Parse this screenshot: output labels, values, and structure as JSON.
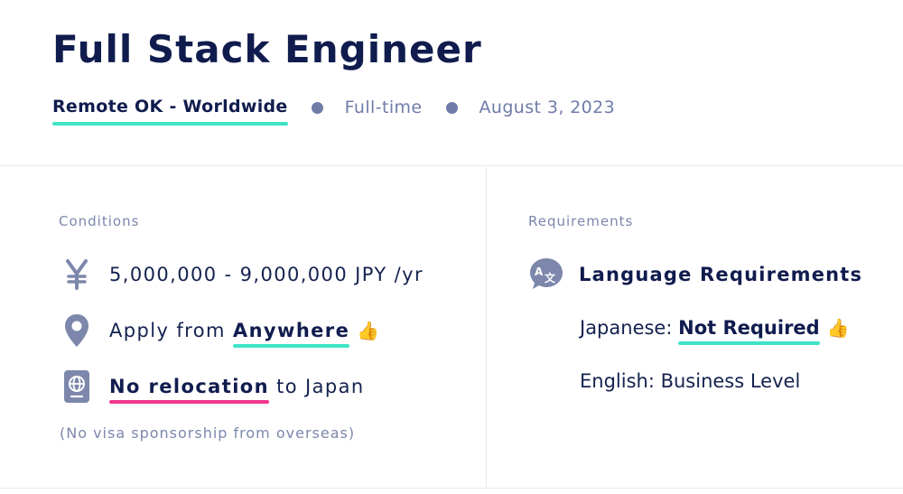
{
  "job": {
    "title": "Full Stack Engineer",
    "location": "Remote OK - Worldwide",
    "type": "Full-time",
    "date": "August 3, 2023"
  },
  "conditions": {
    "label": "Conditions",
    "salary": "5,000,000 - 9,000,000 JPY /yr",
    "apply_prefix": "Apply from",
    "apply_highlight": "Anywhere",
    "relocation_highlight": "No relocation",
    "relocation_suffix": "to Japan",
    "note": "(No visa sponsorship from overseas)",
    "thumbs_emoji": "👍"
  },
  "requirements": {
    "label": "Requirements",
    "heading": "Language Requirements",
    "japanese_prefix": "Japanese:",
    "japanese_value": "Not Required",
    "english": "English: Business Level",
    "thumbs_emoji": "👍"
  },
  "icons": {
    "salary": "yen-icon",
    "location": "map-pin-icon",
    "relocation": "passport-icon",
    "language": "translate-icon"
  },
  "colors": {
    "title": "#101c4e",
    "muted": "#6f7ca8",
    "accent_teal": "#3fe3c8",
    "accent_pink": "#f0368f"
  }
}
